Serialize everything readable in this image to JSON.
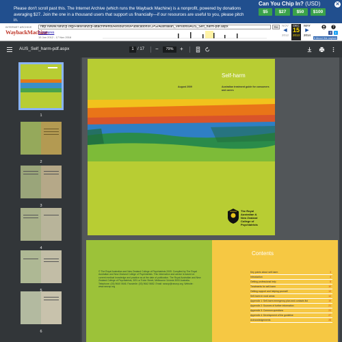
{
  "banner": {
    "message": "Please don't scroll past this. The Internet Archive (which runs the Wayback Machine) is a nonprofit, powered by donations averaging $27. Join the one in a thousand users that support us financially—if our resources are useful to you, please pitch in.",
    "chip_title": "Can You Chip In?",
    "currency": "(USD)",
    "amounts": [
      "$5",
      "$27",
      "$50",
      "$100"
    ],
    "close_glyph": "✕"
  },
  "wayback": {
    "logo_top": "INTERNET ARCHIVE",
    "logo_main": "WaybackMachine",
    "url": "http://www.ranzcp.org/Files/ranzcp-attachments/Resources/Publications/CPG/Australian_Versions/AUS_Self_harm-pdf.aspx",
    "go_label": "Go",
    "captures": "6 captures",
    "date_range": "15 Jan 2012 - 17 Nov 2016",
    "calendar": {
      "prev_month": "NOV",
      "month": "DEC",
      "next_month": "MAY",
      "day": "15",
      "prev_year": "2012",
      "year": "2013",
      "next_year": "2014"
    },
    "about_label": "▾ About this capture"
  },
  "pdf_toolbar": {
    "filename": "AUS_Self_harm-pdf.aspx",
    "current_page": "1",
    "total_pages": "/ 17",
    "zoom": "79%",
    "minus": "−",
    "plus": "+"
  },
  "thumbnails": [
    {
      "num": "1",
      "selected": true
    },
    {
      "num": "2",
      "selected": false
    },
    {
      "num": "3",
      "selected": false
    },
    {
      "num": "4",
      "selected": false
    },
    {
      "num": "5",
      "selected": false
    },
    {
      "num": "6",
      "selected": false
    }
  ],
  "cover": {
    "title": "Self-harm",
    "date": "August 2009",
    "subtitle": "Australian treatment guide for consumers and carers",
    "org_lines": [
      "The Royal",
      "Australian &",
      "New Zealand",
      "College of",
      "Psychiatrists"
    ]
  },
  "page2": {
    "left_text": "© The Royal Australian and New Zealand College of Psychiatrists 2009. Compiled by The Royal Australian and New Zealand College of Psychiatrists. This information and advice is based on current medical knowledge and practice as at the date of publication. The Royal Australian and New Zealand College of Psychiatrists, 309 La Trobe Street, Melbourne Victoria 3000 Australia. Telephone: (03) 9640 0646. Facsimile: (03) 9642 5652. Email: ranzcp@ranzcp.org. Website: www.ranzcp.org",
    "contents_title": "Contents",
    "toc": [
      {
        "label": "Key points about self-harm",
        "page": "3"
      },
      {
        "label": "Introduction",
        "page": "4"
      },
      {
        "label": "Getting professional help",
        "page": "8"
      },
      {
        "label": "Treatments for self-harm",
        "page": "10"
      },
      {
        "label": "Getting support and helping yourself",
        "page": "13"
      },
      {
        "label": "Self-harm in rural areas",
        "page": "14"
      },
      {
        "label": "Appendix 1: Self-harm emergency plan and contacts list",
        "page": "19"
      },
      {
        "label": "Appendix 2: Sources of further information",
        "page": "21"
      },
      {
        "label": "Appendix 3: Common questions",
        "page": "23"
      },
      {
        "label": "Appendix 4: Development of the guideline",
        "page": "27"
      },
      {
        "label": "Acknowledgements",
        "page": "28"
      }
    ]
  },
  "colors": {
    "banner_bg": "#214f8e",
    "donate_green": "#3aa24a",
    "toolbar_bg": "#323639",
    "viewer_bg": "#525659",
    "cover_green": "#b8cd33",
    "contents_yellow": "#f6c843"
  }
}
